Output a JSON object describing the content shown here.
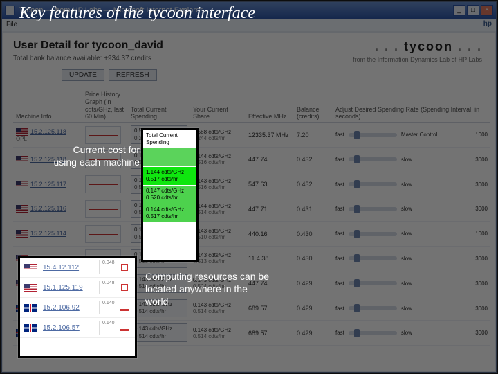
{
  "slide_title": "Key features of the tycoon interface",
  "callout_1": "Current cost for using each machine",
  "callout_2": "Computing resources can be located anywhere in the world",
  "browser": {
    "title": "Tycoon — from HP Labs — Microsoft Internet Explorer",
    "menu": "File",
    "hp_label": "hp"
  },
  "page": {
    "title_prefix": "User Detail for ",
    "user": "tycoon_david",
    "balance_line": "Total bank balance available: +934.37 credits",
    "brand_dots": ". . .",
    "brand_word": " tycoon ",
    "brand_sub": "from the Information Dynamics Lab of HP Labs",
    "btn_update": "UPDATE",
    "btn_refresh": "REFRESH"
  },
  "headers": {
    "machine": "Machine Info",
    "graph": "Price History Graph (in cdts/GHz, last 60 Min)",
    "spend": "Total Current Spending",
    "share": "Your Current Share",
    "mhz": "Effective MHz",
    "balance": "Balance (credits)",
    "adjust": "Adjust Desired Spending Rate (Spending Interval, in seconds)"
  },
  "price_highlight": {
    "header": "Total Current Spending",
    "rows": [
      {
        "l1": "",
        "l2": ""
      },
      {
        "l1": "1.144 cdts/GHz",
        "l2": "0.517 cdts/hr"
      },
      {
        "l1": "0.147 cdts/GHz",
        "l2": "0.520 cdts/hr"
      },
      {
        "l1": "0.144 cdts/GHz",
        "l2": "0.517 cdts/hr"
      }
    ]
  },
  "rows": [
    {
      "flag": "us",
      "host": "15.2.125.118",
      "sub": "OPL",
      "share_l1": "0.588 cdts/GHz",
      "share_l2": "0.244 cdts/hr",
      "mhz": "12335.37 MHz",
      "bal": "7.20",
      "adj_l": "fast",
      "adj_r": "Master Control",
      "adj_v": "1000",
      "slow": "slow"
    },
    {
      "flag": "us",
      "host": "15.2.125.118",
      "sub": "",
      "share_l1": "0.144 cdts/GHz",
      "share_l2": "0.516 cdts/hr",
      "mhz": "447.74",
      "bal": "0.432",
      "adj_l": "fast",
      "adj_r": "slow",
      "adj_v": "3000",
      "slow": ""
    },
    {
      "flag": "us",
      "host": "15.2.125.117",
      "sub": "",
      "share_l1": "0.143 cdts/GHz",
      "share_l2": "0.516 cdts/hr",
      "mhz": "547.63",
      "bal": "0.432",
      "adj_l": "fast",
      "adj_r": "slow",
      "adj_v": "3000",
      "slow": ""
    },
    {
      "flag": "us",
      "host": "15.2.125.116",
      "sub": "",
      "share_l1": "0.144 cdts/GHz",
      "share_l2": "0.514 cdts/hr",
      "mhz": "447.71",
      "bal": "0.431",
      "adj_l": "fast",
      "adj_r": "slow",
      "adj_v": "3000",
      "slow": ""
    },
    {
      "flag": "us",
      "host": "15.2.125.114",
      "sub": "",
      "share_l1": "0.143 cdts/GHz",
      "share_l2": "0.510 cdts/hr",
      "mhz": "440.16",
      "bal": "0.430",
      "adj_l": "fast",
      "adj_r": "slow",
      "adj_v": "1000",
      "slow": ""
    },
    {
      "flag": "us",
      "host": "15.4.12.112",
      "sub": "",
      "share_l1": "0.143 cdts/GHz",
      "share_l2": "0.513 cdts/hr",
      "mhz": "11.4.38",
      "bal": "0.430",
      "adj_l": "fast",
      "adj_r": "slow",
      "adj_v": "3000",
      "slow": ""
    },
    {
      "flag": "us",
      "host": "15.1.125.119",
      "sub": "",
      "share_l1": "0.143 cdts/GHz",
      "share_l2": "0.514 cdts/hr",
      "mhz": "447.74",
      "bal": "0.429",
      "adj_l": "fast",
      "adj_r": "slow",
      "adj_v": "3000",
      "slow": ""
    },
    {
      "flag": "uk",
      "host": "15.2.106.92",
      "sub": "",
      "share_l1": "0.143 cdts/GHz",
      "share_l2": "0.514 cdts/hr",
      "mhz": "689.57",
      "bal": "0.429",
      "adj_l": "fast",
      "adj_r": "slow",
      "adj_v": "3000",
      "slow": ""
    },
    {
      "flag": "uk",
      "host": "15.2.106.57",
      "sub": "",
      "share_l1": "0.143 cdts/GHz",
      "share_l2": "0.514 cdts/hr",
      "mhz": "689.57",
      "bal": "0.429",
      "adj_l": "fast",
      "adj_r": "slow",
      "adj_v": "3000",
      "slow": ""
    }
  ],
  "flag_highlight": {
    "rows": [
      {
        "flag": "us",
        "host": "15.4.12.112",
        "val": "0.048"
      },
      {
        "flag": "us",
        "host": "15.1.125.119",
        "val": "0.048"
      },
      {
        "flag": "uk",
        "host": "15.2.106.92",
        "val": "0.140"
      },
      {
        "flag": "uk",
        "host": "15.2.106.57",
        "val": "0.140"
      }
    ]
  }
}
